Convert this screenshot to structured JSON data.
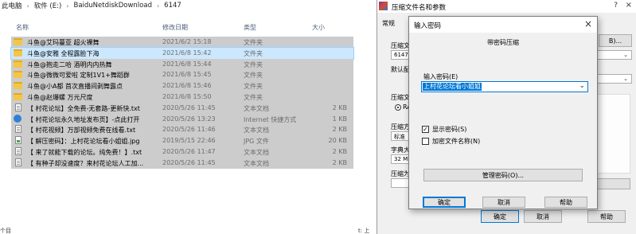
{
  "explorer": {
    "breadcrumb": [
      "此电脑",
      "软件 (E:)",
      "BaiduNetdiskDownload",
      "6147"
    ],
    "columns": {
      "name": "名称",
      "date": "修改日期",
      "type": "类型",
      "size": "大小"
    },
    "rows": [
      {
        "name": "斗鱼@艾玛蔓亚 超火裸舞",
        "date": "2021/6/2 15:18",
        "type": "文件夹",
        "size": "",
        "icon": "folder-icon"
      },
      {
        "name": "斗鱼@安雅 全程露脸下海",
        "date": "2021/6/8 15:42",
        "type": "文件夹",
        "size": "",
        "icon": "folder-icon"
      },
      {
        "name": "斗鱼@抱走二哈 酒明内内热舞",
        "date": "2021/6/8 15:44",
        "type": "文件夹",
        "size": "",
        "icon": "folder-icon"
      },
      {
        "name": "斗鱼@微微可爱啦 定制1V1+舞蹈群",
        "date": "2021/6/8 15:45",
        "type": "文件夹",
        "size": "",
        "icon": "folder-icon"
      },
      {
        "name": "斗鱼@小A都 首次直播间剥舞露点",
        "date": "2021/6/8 15:46",
        "type": "文件夹",
        "size": "",
        "icon": "folder-icon"
      },
      {
        "name": "斗鱼@赵爆螺 万元尺度",
        "date": "2021/6/8 15:50",
        "type": "文件夹",
        "size": "",
        "icon": "folder-icon"
      },
      {
        "name": "【 村花论坛】全免费-无套路-更新快.txt",
        "date": "2020/5/26 11:45",
        "type": "文本文档",
        "size": "2 KB",
        "icon": "text-file-icon"
      },
      {
        "name": "【 村花论坛永久地址发布页】-点此打开",
        "date": "2020/5/26 13:23",
        "type": "Internet 快捷方式",
        "size": "1 KB",
        "icon": "internet-shortcut-icon"
      },
      {
        "name": "【 村花视频】万部视频免费在线看.txt",
        "date": "2020/5/26 11:46",
        "type": "文本文档",
        "size": "2 KB",
        "icon": "text-file-icon"
      },
      {
        "name": "【 解压密码】：上村花论坛看小姐姐.jpg",
        "date": "2019/5/15 22:46",
        "type": "JPG 文件",
        "size": "20 KB",
        "icon": "image-file-icon"
      },
      {
        "name": "【 来了就能下载的论坛。纯免费！】.txt",
        "date": "2020/5/26 11:47",
        "type": "文本文档",
        "size": "2 KB",
        "icon": "text-file-icon"
      },
      {
        "name": "【 有种子却没速度？来村花论坛人工加...",
        "date": "2020/5/26 11:45",
        "type": "文本文档",
        "size": "2 KB",
        "icon": "text-file-icon"
      }
    ],
    "bottom_text": "t: 上",
    "status_bar": "个目"
  },
  "archive_dialog": {
    "title": "压缩文件名和参数",
    "help_glyph": "?",
    "close_glyph": "×",
    "tab_general": "常规",
    "archive_name_label": "压缩文",
    "archive_name_value": "6147.r",
    "browse_button": "B)...",
    "default_profile_label": "默认配",
    "compress_format_label": "压缩文",
    "radio_rar": "RA",
    "method_label": "压缩方",
    "method_value": "标准",
    "dict_label": "字典大",
    "dict_value": "32 MB",
    "split_label": "压缩为",
    "ok_button": "确定",
    "cancel_button": "取消",
    "help_button": "帮助"
  },
  "password_dialog": {
    "title": "输入密码",
    "close_glyph": "×",
    "subtitle": "带密码压缩",
    "password_label": "输入密码(E)",
    "password_value": "上村花论坛看小姐姐",
    "show_password_label": "显示密码(S)",
    "show_password_checked": true,
    "encrypt_names_label": "加密文件名称(N)",
    "encrypt_names_checked": false,
    "manage_button": "管理密码(O)...",
    "ok_button": "确定",
    "cancel_button": "取消",
    "help_button": "帮助"
  }
}
